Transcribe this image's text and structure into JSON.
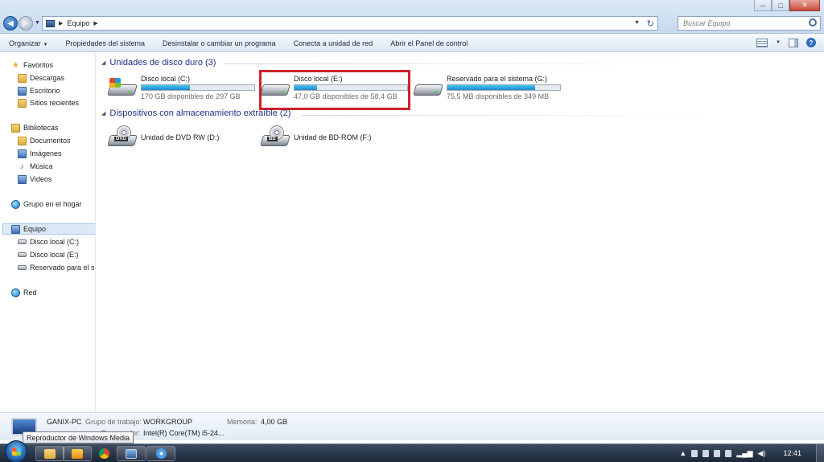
{
  "window": {
    "minimize": "─",
    "maximize": "□",
    "close": "✕"
  },
  "address": {
    "crumb": "Equipo",
    "search_placeholder": "Buscar Equipo"
  },
  "toolbar": {
    "organize": "Organizar",
    "system_properties": "Propiedades del sistema",
    "uninstall": "Desinstalar o cambiar un programa",
    "map_drive": "Conecta a unidad de red",
    "control_panel": "Abrir el Panel de control"
  },
  "nav": {
    "favorites": "Favoritos",
    "downloads": "Descargas",
    "desktop": "Escritorio",
    "recent": "Sitios recientes",
    "libraries": "Bibliotecas",
    "documents": "Documentos",
    "images": "Imágenes",
    "music": "Música",
    "videos": "Videos",
    "homegroup": "Grupo en el hogar",
    "computer": "Equipo",
    "drive_c": "Disco local (C:)",
    "drive_e": "Disco local (E:)",
    "drive_g": "Reservado para el sis",
    "network": "Red"
  },
  "groups": {
    "hard_drives": "Unidades de disco duro (3)",
    "removable": "Dispositivos con almacenamiento extraíble (2)"
  },
  "drives": [
    {
      "name": "Disco local (C:)",
      "free": "170 GB disponibles de 297 GB",
      "used_fraction": 0.43
    },
    {
      "name": "Disco local (E:)",
      "free": "47,0 GB disponibles de 58,4 GB",
      "used_fraction": 0.2
    },
    {
      "name": "Reservado para el sistema (G:)",
      "free": "75,5 MB disponibles de 349 MB",
      "used_fraction": 0.78
    }
  ],
  "optical": [
    {
      "name": "Unidad de DVD RW (D:)",
      "tag": "DVD"
    },
    {
      "name": "Unidad de BD-ROM (F:)",
      "tag": "BD"
    }
  ],
  "details": {
    "pc_name": "GANIX-PC",
    "workgroup_label": "Grupo de trabajo:",
    "workgroup": "WORKGROUP",
    "memory_label": "Memoria:",
    "memory": "4,00 GB",
    "processor_label": "Procesador:",
    "processor": "Intel(R) Core(TM) i5-24..."
  },
  "tooltip": "Reproductor de Windows Media",
  "taskbar": {
    "clock": "12:41"
  },
  "colors": {
    "highlight": "#d0202a",
    "bar_fill": "#1d8bcf",
    "group_header": "#1e3287"
  }
}
